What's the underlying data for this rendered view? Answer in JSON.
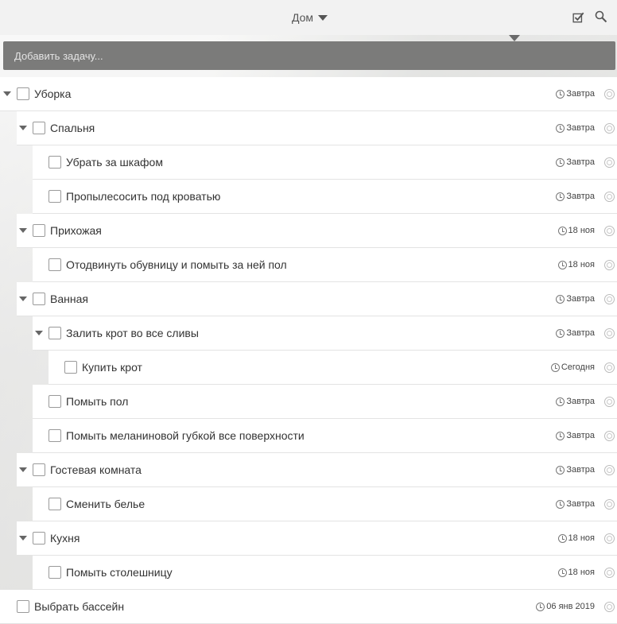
{
  "header": {
    "list_name": "Дом",
    "icons": [
      "checkbox-icon",
      "search-icon"
    ]
  },
  "add_task": {
    "placeholder": "Добавить задачу..."
  },
  "tasks": [
    {
      "title": "Уборка",
      "due": "Завтра",
      "level": 0,
      "expandable": true
    },
    {
      "title": "Спальня",
      "due": "Завтра",
      "level": 1,
      "expandable": true
    },
    {
      "title": "Убрать за шкафом",
      "due": "Завтра",
      "level": 2,
      "expandable": false
    },
    {
      "title": "Пропылесосить под кроватью",
      "due": "Завтра",
      "level": 2,
      "expandable": false
    },
    {
      "title": "Прихожая",
      "due": "18 ноя",
      "level": 1,
      "expandable": true
    },
    {
      "title": "Отодвинуть обувницу и помыть за ней пол",
      "due": "18 ноя",
      "level": 2,
      "expandable": false
    },
    {
      "title": "Ванная",
      "due": "Завтра",
      "level": 1,
      "expandable": true
    },
    {
      "title": "Залить крот во все сливы",
      "due": "Завтра",
      "level": 2,
      "expandable": true
    },
    {
      "title": "Купить крот",
      "due": "Сегодня",
      "level": 3,
      "expandable": false
    },
    {
      "title": "Помыть пол",
      "due": "Завтра",
      "level": 2,
      "expandable": false
    },
    {
      "title": "Помыть меланиновой губкой все поверхности",
      "due": "Завтра",
      "level": 2,
      "expandable": false
    },
    {
      "title": "Гостевая комната",
      "due": "Завтра",
      "level": 1,
      "expandable": true
    },
    {
      "title": "Сменить белье",
      "due": "Завтра",
      "level": 2,
      "expandable": false
    },
    {
      "title": "Кухня",
      "due": "18 ноя",
      "level": 1,
      "expandable": true
    },
    {
      "title": "Помыть столешницу",
      "due": "18 ноя",
      "level": 2,
      "expandable": false
    },
    {
      "title": "Выбрать бассейн",
      "due": "06 янв 2019",
      "level": 0,
      "expandable": false
    }
  ]
}
